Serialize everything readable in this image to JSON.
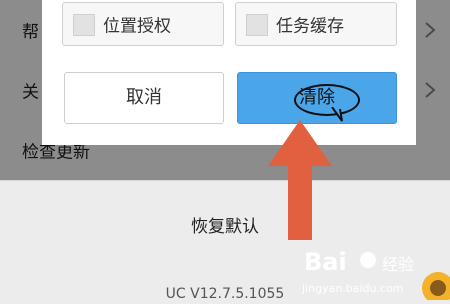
{
  "settings": {
    "help_label": "帮",
    "about_label": "关",
    "check_update": "检查更新",
    "restore_default": "恢复默认",
    "version": "UC V12.7.5.1055"
  },
  "dialog": {
    "option_location": "位置授权",
    "option_cache": "任务缓存",
    "cancel_label": "取消",
    "clear_label": "清除"
  },
  "colors": {
    "accent_blue": "#4aa6e8",
    "arrow_red": "#e06040"
  },
  "watermark": {
    "brand": "Bai",
    "brand_suffix": "经验",
    "url": "jingyan.baidu.com"
  }
}
